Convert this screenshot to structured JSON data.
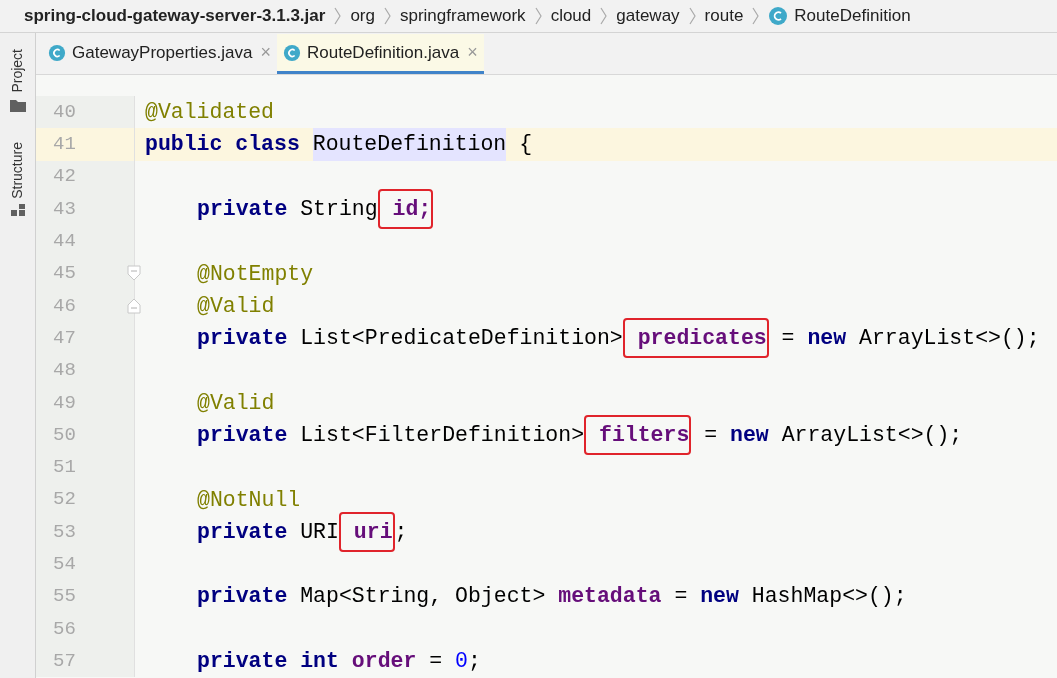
{
  "breadcrumbs": [
    {
      "text": "spring-cloud-gateway-server-3.1.3.jar",
      "kind": "jar"
    },
    {
      "text": "org",
      "kind": "package"
    },
    {
      "text": "springframework",
      "kind": "package"
    },
    {
      "text": "cloud",
      "kind": "package"
    },
    {
      "text": "gateway",
      "kind": "package"
    },
    {
      "text": "route",
      "kind": "package"
    },
    {
      "text": "RouteDefinition",
      "kind": "class"
    }
  ],
  "tool_strip": [
    {
      "label": "Project",
      "kind": "folder"
    },
    {
      "label": "Structure",
      "kind": "structure"
    }
  ],
  "tabs": [
    {
      "label": "GatewayProperties.java",
      "selected": false,
      "close": "×"
    },
    {
      "label": "RouteDefinition.java",
      "selected": true,
      "close": "×"
    }
  ],
  "lines": [
    {
      "number": "40",
      "kind": "code",
      "current": false,
      "indent": false,
      "tokens": [
        {
          "kind": "annotation",
          "text": "@Validated"
        }
      ]
    },
    {
      "number": "41",
      "kind": "code",
      "current": true,
      "indent": false,
      "tokens": [
        {
          "kind": "keyword",
          "text": "public class "
        },
        {
          "kind": "highlight",
          "text": "RouteDefinition"
        },
        {
          "kind": "plain",
          "text": " {"
        }
      ]
    },
    {
      "number": "42",
      "kind": "code",
      "current": false,
      "indent": false
    },
    {
      "number": "43",
      "kind": "code",
      "current": false,
      "indent": true,
      "tokens": [
        {
          "kind": "keyword",
          "text": "private "
        },
        {
          "kind": "plain",
          "text": "String"
        },
        {
          "kind": "field",
          "text": " id;",
          "boxed": true
        }
      ]
    },
    {
      "number": "44",
      "kind": "code",
      "current": false,
      "indent": false
    },
    {
      "number": "45",
      "kind": "fold_start",
      "current": false,
      "indent": true,
      "tokens": [
        {
          "kind": "annotation",
          "text": "@NotEmpty"
        }
      ]
    },
    {
      "number": "46",
      "kind": "fold_end",
      "current": false,
      "indent": true,
      "tokens": [
        {
          "kind": "annotation",
          "text": "@Valid"
        }
      ]
    },
    {
      "number": "47",
      "kind": "code",
      "current": false,
      "indent": true,
      "tokens": [
        {
          "kind": "keyword",
          "text": "private "
        },
        {
          "kind": "plain",
          "text": "List<PredicateDefinition>"
        },
        {
          "kind": "field",
          "text": " predicates",
          "boxed": true
        },
        {
          "kind": "plain",
          "text": " = "
        },
        {
          "kind": "keyword",
          "text": "new "
        },
        {
          "kind": "plain",
          "text": "ArrayList<>();"
        }
      ]
    },
    {
      "number": "48",
      "kind": "code",
      "current": false,
      "indent": false
    },
    {
      "number": "49",
      "kind": "code",
      "current": false,
      "indent": true,
      "tokens": [
        {
          "kind": "annotation",
          "text": "@Valid"
        }
      ]
    },
    {
      "number": "50",
      "kind": "code",
      "current": false,
      "indent": true,
      "tokens": [
        {
          "kind": "keyword",
          "text": "private "
        },
        {
          "kind": "plain",
          "text": "List<FilterDefinition>"
        },
        {
          "kind": "field",
          "text": " filters",
          "boxed": true
        },
        {
          "kind": "plain",
          "text": " = "
        },
        {
          "kind": "keyword",
          "text": "new "
        },
        {
          "kind": "plain",
          "text": "ArrayList<>();"
        }
      ]
    },
    {
      "number": "51",
      "kind": "code",
      "current": false,
      "indent": false
    },
    {
      "number": "52",
      "kind": "code",
      "current": false,
      "indent": true,
      "tokens": [
        {
          "kind": "annotation",
          "text": "@NotNull"
        }
      ]
    },
    {
      "number": "53",
      "kind": "code",
      "current": false,
      "indent": true,
      "tokens": [
        {
          "kind": "keyword",
          "text": "private "
        },
        {
          "kind": "plain",
          "text": "URI"
        },
        {
          "kind": "field",
          "text": " uri",
          "boxed": true
        },
        {
          "kind": "plain",
          "text": ";"
        }
      ]
    },
    {
      "number": "54",
      "kind": "code",
      "current": false,
      "indent": false
    },
    {
      "number": "55",
      "kind": "code",
      "current": false,
      "indent": true,
      "tokens": [
        {
          "kind": "keyword",
          "text": "private "
        },
        {
          "kind": "plain",
          "text": "Map<String, Object> "
        },
        {
          "kind": "field",
          "text": "metadata"
        },
        {
          "kind": "plain",
          "text": " = "
        },
        {
          "kind": "keyword",
          "text": "new "
        },
        {
          "kind": "plain",
          "text": "HashMap<>();"
        }
      ]
    },
    {
      "number": "56",
      "kind": "code",
      "current": false,
      "indent": false
    },
    {
      "number": "57",
      "kind": "code",
      "current": false,
      "indent": true,
      "tokens": [
        {
          "kind": "keyword",
          "text": "private int "
        },
        {
          "kind": "field",
          "text": "order"
        },
        {
          "kind": "plain",
          "text": " = "
        },
        {
          "kind": "number",
          "text": "0"
        },
        {
          "kind": "plain",
          "text": ";"
        }
      ]
    }
  ]
}
